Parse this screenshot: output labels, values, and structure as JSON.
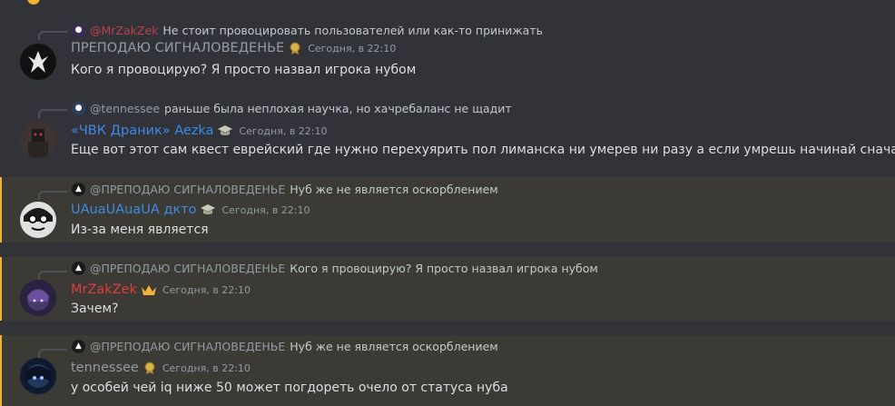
{
  "colors": {
    "background": "#313338",
    "mention_background": "#3b3a34",
    "mention_bar": "#f0b232",
    "timestamp": "#949ba4",
    "name_grey": "#949ba4",
    "name_blue": "#3e8ae6",
    "name_red": "#e03d3d",
    "name_reply_red": "#b8434b"
  },
  "messages": [
    {
      "reply": {
        "author": "@MrZakZek",
        "text": "Не стоит провоцировать пользователей или как-то принижать"
      },
      "author": "ПРЕПОДАЮ СИГНАЛОВЕДЕНЬЕ",
      "badge_icon": "medal-icon",
      "timestamp": "Сегодня, в 22:10",
      "content": "Кого я провоцирую? Я просто назвал игрока нубом"
    },
    {
      "reply": {
        "author": "@tennessee",
        "text": "раньше была неплохая научка, но хачребаланс не щадит"
      },
      "author": "«ЧВК Драник» Aezka",
      "badge_icon": "graduation-cap-icon",
      "timestamp": "Сегодня, в 22:10",
      "content": "Еще вот этот сам квест еврейский где нужно перехуярить пол лиманска ни умерев ни разу а если умрешь начинай сначала"
    },
    {
      "reply": {
        "author": "@ПРЕПОДАЮ СИГНАЛОВЕДЕНЬЕ",
        "text": "Нуб же не является оскорблением"
      },
      "author": "UAuaUAuaUA дкто",
      "badge_icon": "graduation-cap-icon",
      "timestamp": "Сегодня, в 22:10",
      "content": "Из-за меня является"
    },
    {
      "reply": {
        "author": "@ПРЕПОДАЮ СИГНАЛОВЕДЕНЬЕ",
        "text": "Кого я провоцирую? Я просто назвал игрока нубом"
      },
      "author": "MrZakZek",
      "badge_icon": "crown-icon",
      "timestamp": "Сегодня, в 22:10",
      "content": "Зачем?"
    },
    {
      "reply": {
        "author": "@ПРЕПОДАЮ СИГНАЛОВЕДЕНЬЕ",
        "text": "Нуб же не является оскорблением"
      },
      "author": "tennessee",
      "badge_icon": "medal-icon",
      "timestamp": "Сегодня, в 22:10",
      "content": "у особей чей iq ниже 50 может погдореть очело от статуса нуба"
    }
  ]
}
